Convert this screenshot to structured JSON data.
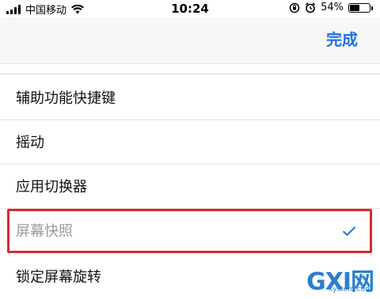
{
  "status_bar": {
    "carrier": "中国移动",
    "time": "10:24",
    "battery_text": "54%",
    "battery_level": 0.54,
    "icons": [
      "signal-icon",
      "wifi-icon",
      "rotation-lock-icon",
      "alarm-icon",
      "battery-icon"
    ]
  },
  "nav": {
    "done_label": "完成",
    "accent_color": "#1a73e8"
  },
  "list": {
    "items": [
      {
        "label": "辅助功能快捷键"
      },
      {
        "label": "摇动"
      },
      {
        "label": "应用切换器"
      },
      {
        "label": "屏幕快照",
        "selected": true
      },
      {
        "label": "锁定屏幕旋转"
      }
    ]
  },
  "highlight_color": "#d9282e",
  "watermark": {
    "main": "GXI网",
    "sub": "system.com"
  }
}
